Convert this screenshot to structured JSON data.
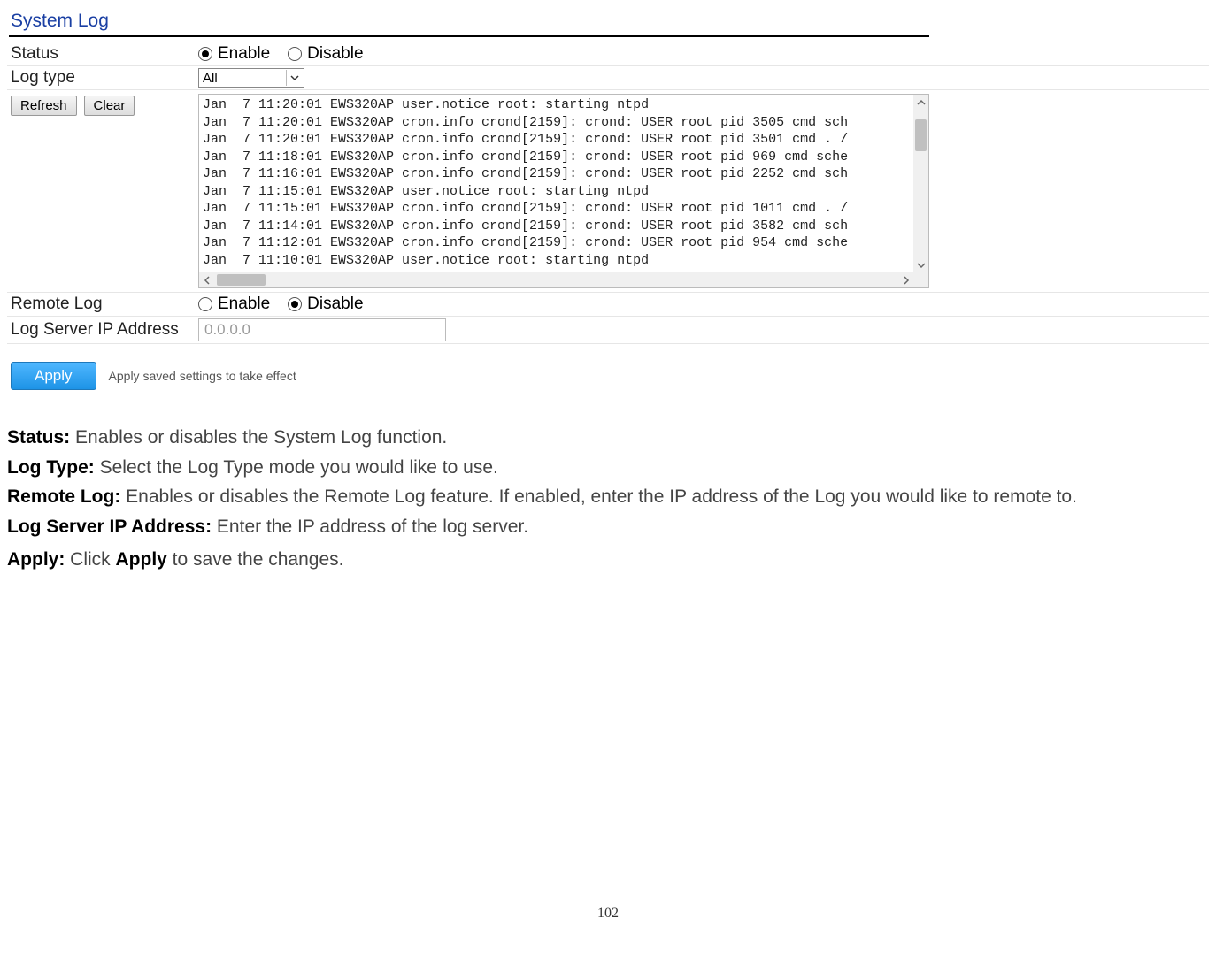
{
  "panel": {
    "title": "System Log",
    "status": {
      "label": "Status",
      "enable": "Enable",
      "disable": "Disable",
      "selected": "enable"
    },
    "logtype": {
      "label": "Log type",
      "selected": "All"
    },
    "buttons": {
      "refresh": "Refresh",
      "clear": "Clear"
    },
    "log_lines": [
      "Jan  7 11:20:01 EWS320AP user.notice root: starting ntpd",
      "Jan  7 11:20:01 EWS320AP cron.info crond[2159]: crond: USER root pid 3505 cmd sch",
      "Jan  7 11:20:01 EWS320AP cron.info crond[2159]: crond: USER root pid 3501 cmd . /",
      "Jan  7 11:18:01 EWS320AP cron.info crond[2159]: crond: USER root pid 969 cmd sche",
      "Jan  7 11:16:01 EWS320AP cron.info crond[2159]: crond: USER root pid 2252 cmd sch",
      "Jan  7 11:15:01 EWS320AP user.notice root: starting ntpd",
      "Jan  7 11:15:01 EWS320AP cron.info crond[2159]: crond: USER root pid 1011 cmd . /",
      "Jan  7 11:14:01 EWS320AP cron.info crond[2159]: crond: USER root pid 3582 cmd sch",
      "Jan  7 11:12:01 EWS320AP cron.info crond[2159]: crond: USER root pid 954 cmd sche",
      "Jan  7 11:10:01 EWS320AP user.notice root: starting ntpd"
    ],
    "remote": {
      "label": "Remote Log",
      "enable": "Enable",
      "disable": "Disable",
      "selected": "disable"
    },
    "ip": {
      "label": "Log Server IP Address",
      "value": "0.0.0.0"
    },
    "apply": {
      "button": "Apply",
      "note": "Apply saved settings to take effect"
    }
  },
  "doc": {
    "status_b": "Status:",
    "status_t": " Enables or disables the System Log function.",
    "logtype_b": "Log Type:",
    "logtype_t": " Select the Log Type mode you would like to use.",
    "remote_b": "Remote Log:",
    "remote_t": " Enables or disables the Remote Log feature. If enabled, enter the IP address of the Log you would like to remote to.",
    "ip_b": "Log Server IP Address:",
    "ip_t": " Enter the IP address of the log server.",
    "apply_b": "Apply:",
    "apply_t1": " Click ",
    "apply_w": "Apply",
    "apply_t2": " to save the changes."
  },
  "page_number": "102"
}
